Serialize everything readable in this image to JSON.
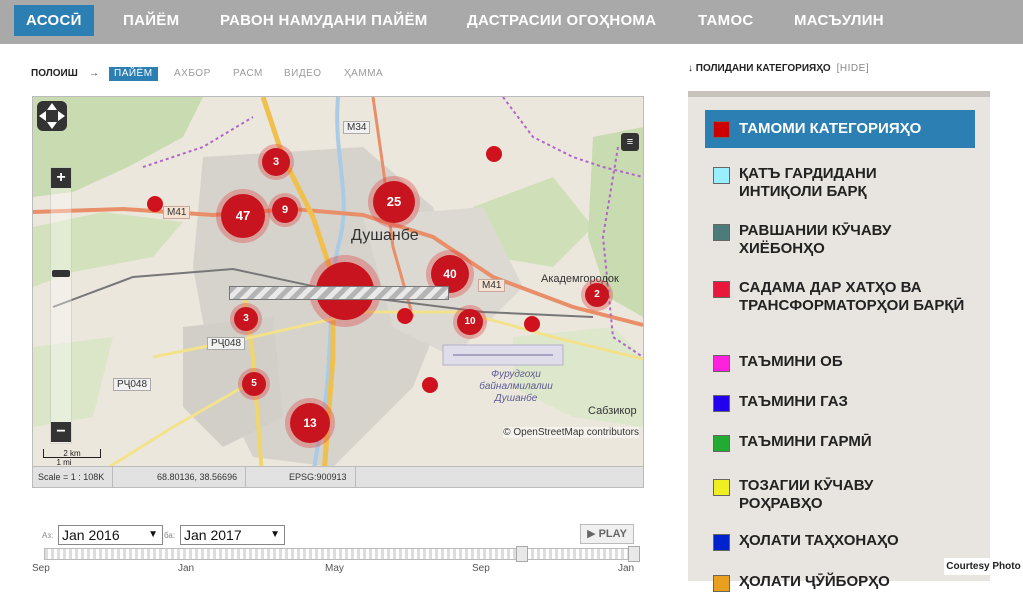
{
  "nav": {
    "items": [
      "АСОСӢ",
      "ПАЙЁМ",
      "РАВОН НАМУДАНИ ПАЙЁМ",
      "ДАСТРАСИИ ОГОҲНОМА",
      "ТАМОС",
      "МАСЪУЛИН"
    ],
    "active": 0
  },
  "filter": {
    "label": "ПОЛОИШ",
    "arrow": "→",
    "options": [
      "ПАЙЁМ",
      "АХБОР",
      "РАСМ",
      "ВИДЕО",
      "ҲАММА"
    ],
    "active": 0
  },
  "map": {
    "city_label": "Душанбе",
    "labels": [
      "Академгородок",
      "Сабзикор",
      "Фурудгоҳи байналмилалии Душанбе"
    ],
    "road_tags": [
      "M34",
      "M41",
      "M41",
      "РҶ048",
      "РҶ048"
    ],
    "clusters": [
      "3",
      "47",
      "9",
      "25",
      "40",
      "2",
      "3",
      "10",
      "5",
      "13"
    ],
    "attribution": "© OpenStreetMap contributors",
    "scale_km": "2 km",
    "scale_mi": "1 mi",
    "zoom_in": "+",
    "zoom_out": "−",
    "status": {
      "scale": "Scale = 1 : 108K",
      "coords": "68.80136, 38.56696",
      "epsg": "EPSG:900913"
    }
  },
  "timeline": {
    "from_label": "Аз:",
    "from_value": "Jan 2016",
    "to_label": "ба:",
    "to_value": "Jan 2017",
    "play_label": "PLAY",
    "months": [
      "Sep",
      "Jan",
      "May",
      "Sep",
      "Jan"
    ]
  },
  "categories": {
    "toggle_label": "↓ ПОЛИДАНИ КАТЕГОРИЯҲО",
    "hide_label": "[HIDE]",
    "items": [
      {
        "label": "ТАМОМИ КАТЕГОРИЯҲО",
        "color": "#cc0000",
        "active": true
      },
      {
        "label": "ҚАТЪ ГАРДИДАНИ ИНТИҚОЛИ БАРҚ",
        "color": "#99eeff"
      },
      {
        "label": "РАВШАНИИ КӮЧАВУ ХИЁБОНҲО",
        "color": "#4d7a7a"
      },
      {
        "label": "САДАМА ДАР ХАТҲО ВА ТРАНСФОРМАТОРҲОИ БАРҚӢ",
        "color": "#e8173c"
      },
      {
        "label": "ТАЪМИНИ ОБ",
        "color": "#ff22dd"
      },
      {
        "label": "ТАЪМИНИ ГАЗ",
        "color": "#2200ee"
      },
      {
        "label": "ТАЪМИНИ ГАРМӢ",
        "color": "#22aa33"
      },
      {
        "label": "ТОЗАГИИ КӮЧАВУ РОҲРАВҲО",
        "color": "#eeee22"
      },
      {
        "label": "ҲОЛАТИ ТАҲХОНАҲО",
        "color": "#0022cc"
      },
      {
        "label": "ҲОЛАТИ ҶӮЙБОРҲО",
        "color": "#e8a020"
      }
    ]
  },
  "credit": "Courtesy Photo"
}
